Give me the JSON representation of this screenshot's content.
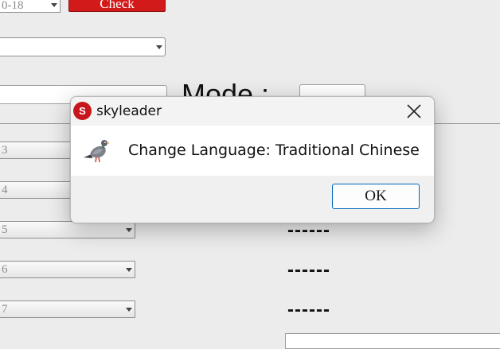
{
  "background": {
    "date_combo_value": "0-18",
    "check_button": "Check",
    "mode_label": "Mode :",
    "rows": [
      {
        "label": "3",
        "status": ""
      },
      {
        "label": "4",
        "status": ""
      },
      {
        "label": "5",
        "status": "------"
      },
      {
        "label": "6",
        "status": "------"
      },
      {
        "label": "7",
        "status": "------"
      }
    ]
  },
  "dialog": {
    "title": "skyleader",
    "app_icon_letter": "S",
    "message": "Change Language: Traditional Chinese",
    "ok_label": "OK",
    "accent_color": "#0067c0",
    "app_icon_color": "#c8161d"
  }
}
